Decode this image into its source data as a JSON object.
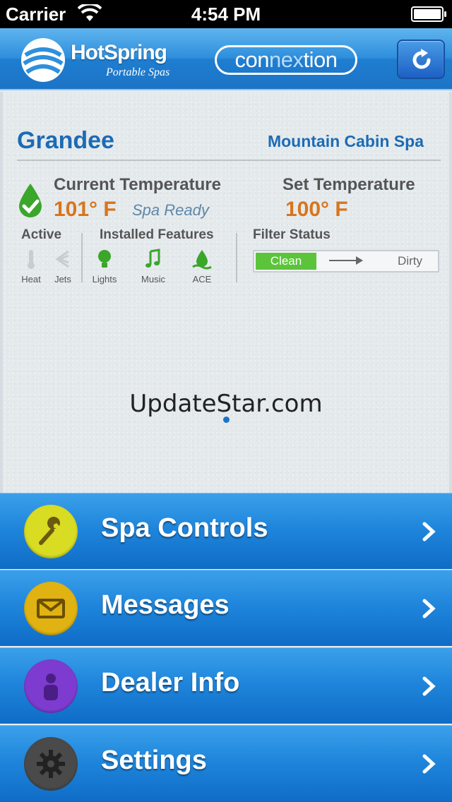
{
  "status_bar": {
    "carrier": "Carrier",
    "time": "4:54 PM"
  },
  "header": {
    "brand": "HotSpring",
    "brand_sub": "Portable Spas",
    "connexion_prefix": "con",
    "connexion_mid": "nex",
    "connexion_suffix": "tion"
  },
  "spa": {
    "name": "Grandee",
    "location": "Mountain Cabin Spa",
    "current_temp_label": "Current Temperature",
    "current_temp_value": "101° F",
    "status": "Spa Ready",
    "set_temp_label": "Set Temperature",
    "set_temp_value": "100° F"
  },
  "active": {
    "title": "Active",
    "items": [
      {
        "label": "Heat",
        "icon": "thermometer-icon"
      },
      {
        "label": "Jets",
        "icon": "jets-icon"
      }
    ]
  },
  "features": {
    "title": "Installed Features",
    "items": [
      {
        "label": "Lights",
        "icon": "bulb-icon"
      },
      {
        "label": "Music",
        "icon": "music-note-icon"
      },
      {
        "label": "ACE",
        "icon": "water-drop-icon"
      }
    ]
  },
  "filter": {
    "title": "Filter Status",
    "clean": "Clean",
    "dirty": "Dirty"
  },
  "watermark": "UpdateStar.com",
  "menu": [
    {
      "label": "Spa Controls",
      "icon": "wrench-icon",
      "color": "#d8dc22"
    },
    {
      "label": "Messages",
      "icon": "envelope-icon",
      "color": "#e0b312"
    },
    {
      "label": "Dealer Info",
      "icon": "person-icon",
      "color": "#7d3ccf"
    },
    {
      "label": "Settings",
      "icon": "gear-icon",
      "color": "#4a4a4a"
    }
  ],
  "colors": {
    "accent": "#1c6bb4",
    "temperature": "#d7751d",
    "clean": "#5bc43b",
    "feature_green": "#3aa62a"
  }
}
